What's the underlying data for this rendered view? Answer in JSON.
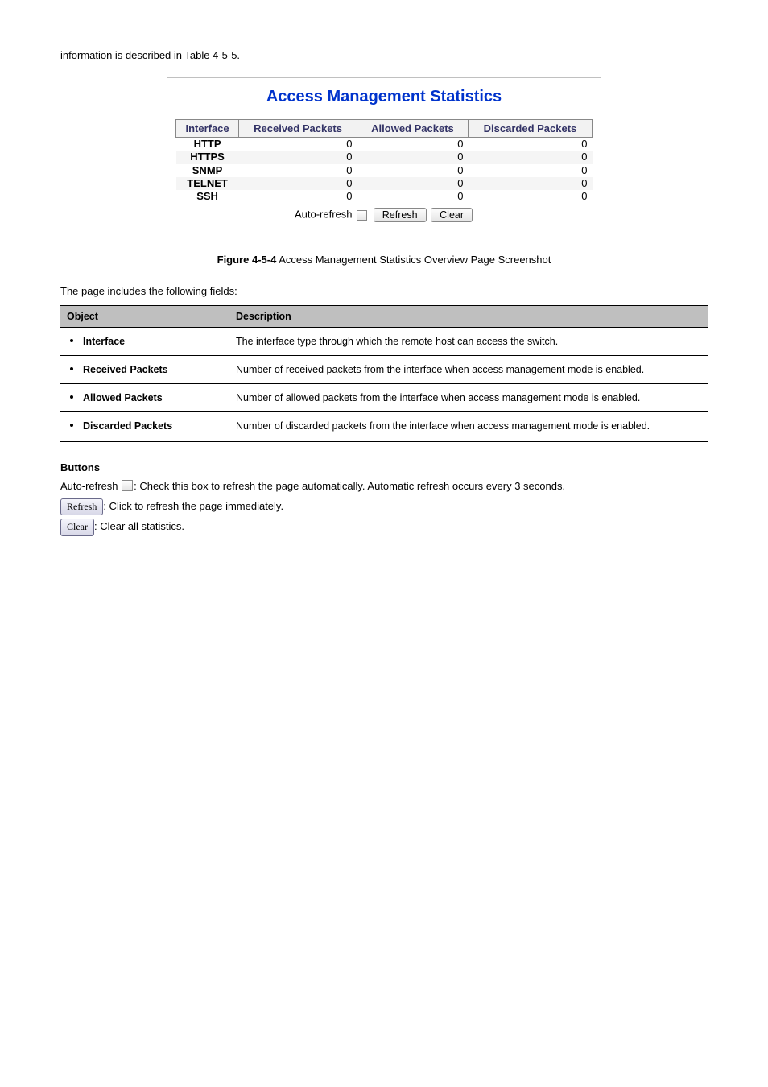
{
  "intro": "information is described in Table 4-5-5.",
  "figure": {
    "title": "Access Management Statistics",
    "headers": [
      "Interface",
      "Received Packets",
      "Allowed Packets",
      "Discarded Packets"
    ],
    "rows": [
      {
        "iface": "HTTP",
        "recv": "0",
        "allow": "0",
        "disc": "0"
      },
      {
        "iface": "HTTPS",
        "recv": "0",
        "allow": "0",
        "disc": "0"
      },
      {
        "iface": "SNMP",
        "recv": "0",
        "allow": "0",
        "disc": "0"
      },
      {
        "iface": "TELNET",
        "recv": "0",
        "allow": "0",
        "disc": "0"
      },
      {
        "iface": "SSH",
        "recv": "0",
        "allow": "0",
        "disc": "0"
      }
    ],
    "auto_refresh_label": "Auto-refresh",
    "refresh_label": "Refresh",
    "clear_label": "Clear"
  },
  "figure_caption": {
    "prefix": "Figure 4-5-4",
    "rest": " Access Management Statistics Overview Page Screenshot"
  },
  "explain_label": "The page includes the following fields:",
  "explain": {
    "headers": {
      "object": "Object",
      "description": "Description"
    },
    "rows": [
      {
        "object": "Interface",
        "desc": "The interface type through which the remote host can access the switch."
      },
      {
        "object": "Received Packets",
        "desc": "Number of received packets from the interface when access management mode is enabled."
      },
      {
        "object": "Allowed Packets",
        "desc": "Number of allowed packets from the interface when access management mode is enabled."
      },
      {
        "object": "Discarded Packets",
        "desc": "Number of discarded packets from the interface when access management mode is enabled."
      }
    ]
  },
  "buttons": {
    "heading": "Buttons",
    "auto_refresh_text_before": "Auto-refresh ",
    "auto_refresh_text_after": ": Check this box to refresh the page automatically. Automatic refresh occurs every 3 seconds.",
    "refresh_label": "Refresh",
    "refresh_desc": ": Click to refresh the page immediately.",
    "clear_label": "Clear",
    "clear_desc": ": Clear all statistics."
  }
}
